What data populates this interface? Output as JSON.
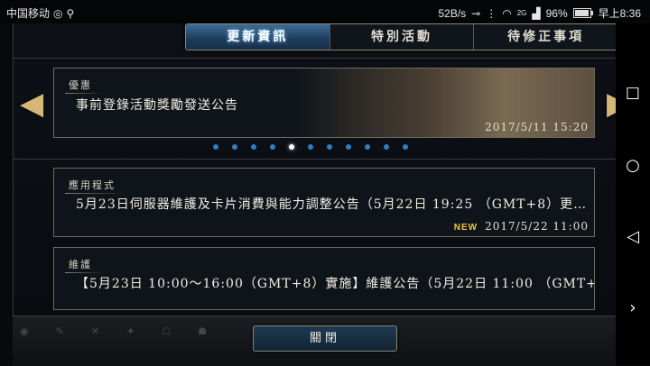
{
  "status_bar": {
    "carrier": "中国移动",
    "net_speed": "52B/s",
    "signal_label": "2G",
    "battery": "96%",
    "battery_level": 0.96,
    "time": "早上8:36"
  },
  "tabs": [
    {
      "label": "更新資訊",
      "active": true
    },
    {
      "label": "特別活動",
      "active": false
    },
    {
      "label": "待修正事項",
      "active": false
    }
  ],
  "carousel": {
    "tag": "優惠",
    "title": "事前登錄活動獎勵發送公告",
    "date": "2017/5/11  15:20",
    "page_count": 11,
    "active_page": 5
  },
  "news": [
    {
      "tag": "應用程式",
      "title": "5月23日伺服器維護及卡片消費與能力調整公告（5月22日 19:25 （GMT+8）更…",
      "badge": "NEW",
      "date": "2017/5/22  11:00"
    },
    {
      "tag": "維護",
      "title": "【5月23日 10:00～16:00（GMT+8）實施】維護公告（5月22日 11:00 （GMT+…",
      "badge": "",
      "date": ""
    }
  ],
  "close_button": "關閉",
  "nav_icons": [
    "square-icon",
    "circle-icon",
    "triangle-back-icon",
    "chevron-right-icon"
  ]
}
